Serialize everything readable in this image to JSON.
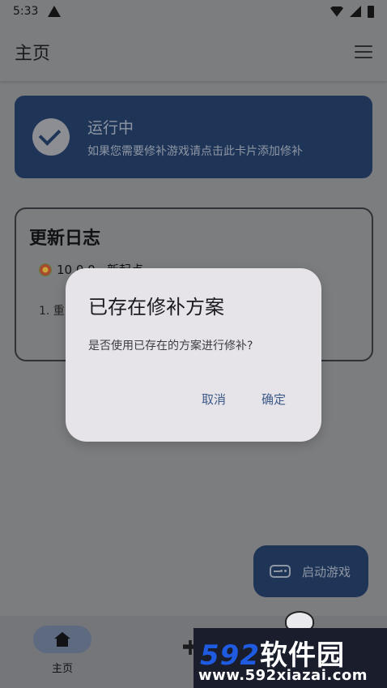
{
  "status_bar": {
    "time": "5:33"
  },
  "app_bar": {
    "title": "主页"
  },
  "status_card": {
    "title": "运行中",
    "subtitle": "如果您需要修补游戏请点击此卡片添加修补"
  },
  "update_log": {
    "title": "更新日志",
    "version": "10.0.0 · 新起点",
    "item_1": "1. 重"
  },
  "fab": {
    "label": "启动游戏"
  },
  "bottom_nav": {
    "items": [
      {
        "label": "主页"
      }
    ]
  },
  "dialog": {
    "title": "已存在修补方案",
    "message": "是否使用已存在的方案进行修补?",
    "cancel": "取消",
    "confirm": "确定"
  },
  "watermark": {
    "brand_num": "592",
    "brand_cn": "软件园",
    "url": "www.592xiazai.com"
  },
  "colors": {
    "scrim_bg": "#7c7d7f",
    "card_bg": "#1f3558",
    "dialog_bg": "#e6e4e9",
    "accent_text": "#3e5a89"
  }
}
